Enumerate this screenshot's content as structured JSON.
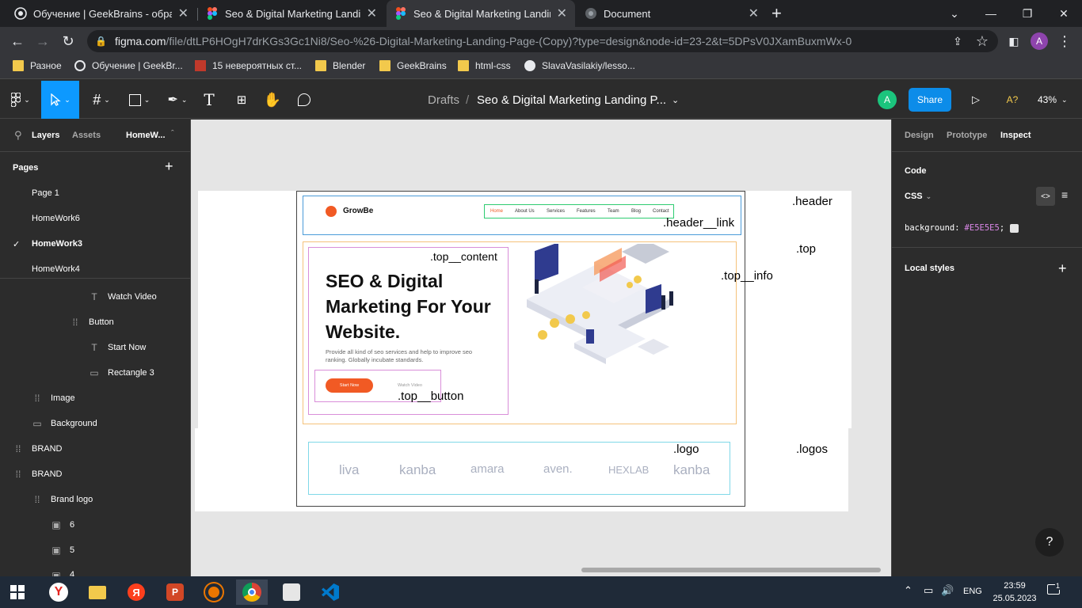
{
  "browser": {
    "tabs": [
      {
        "title": "Обучение | GeekBrains - образо",
        "icon": "geekbrains-icon"
      },
      {
        "title": "Seo & Digital Marketing Landing",
        "icon": "figma-icon"
      },
      {
        "title": "Seo & Digital Marketing Landing",
        "icon": "figma-icon"
      },
      {
        "title": "Document",
        "icon": "globe-icon"
      }
    ],
    "new_tab": "+",
    "url_host": "figma.com",
    "url_path": "/file/dtLP6HOgH7drKGs3Gc1Ni8/Seo-%26-Digital-Marketing-Landing-Page-(Copy)?type=design&node-id=23-2&t=5DPsV0JXamBuxmWx-0",
    "profile_initial": "A",
    "bookmarks": [
      "Разное",
      "Обучение | GeekBr...",
      "15 невероятных ст...",
      "Blender",
      "GeekBrains",
      "html-css",
      "SlavaVasilakiy/lesso..."
    ]
  },
  "figma": {
    "breadcrumb_root": "Drafts",
    "breadcrumb_sep": "/",
    "file_name": "Seo & Digital Marketing Landing P...",
    "user_initial": "A",
    "share_label": "Share",
    "ai_label": "A?",
    "zoom": "43%",
    "left_tabs": {
      "layers": "Layers",
      "assets": "Assets",
      "page": "HomeW..."
    },
    "pages_title": "Pages",
    "add_page": "+",
    "pages": [
      "Page 1",
      "HomeWork6",
      "HomeWork3",
      "HomeWork4"
    ],
    "layers": [
      {
        "label": "Watch Video",
        "icon": "T"
      },
      {
        "label": "Button",
        "icon": "frame"
      },
      {
        "label": "Start Now",
        "icon": "T"
      },
      {
        "label": "Rectangle 3",
        "icon": "rect"
      },
      {
        "label": "Image",
        "icon": "frame"
      },
      {
        "label": "Background",
        "icon": "rect"
      },
      {
        "label": "BRAND",
        "icon": "frame"
      },
      {
        "label": "BRAND",
        "icon": "frame"
      },
      {
        "label": "Brand logo",
        "icon": "frame"
      },
      {
        "label": "6",
        "icon": "image"
      },
      {
        "label": "5",
        "icon": "image"
      },
      {
        "label": "4",
        "icon": "image"
      }
    ],
    "right_tabs": {
      "design": "Design",
      "prototype": "Prototype",
      "inspect": "Inspect"
    },
    "code_title": "Code",
    "css_label": "CSS",
    "css_prop": "background:",
    "css_value": "#E5E5E5",
    "css_semicolon": ";",
    "local_styles": "Local styles",
    "help": "?"
  },
  "design": {
    "brand": "GrowBe",
    "nav": [
      "Home",
      "About Us",
      "Services",
      "Features",
      "Team",
      "Blog",
      "Contact"
    ],
    "hero_title": "SEO & Digital Marketing For Your Website.",
    "hero_text": "Provide all kind of seo services and help to improve seo ranking. Globally incubate standards.",
    "start_now": "Start Now",
    "watch_video": "Watch Video",
    "logos": [
      "liva",
      "kanba",
      "amara",
      "aven.",
      "HEXLAB",
      "kanba"
    ],
    "labels": {
      "header": ".header",
      "header_link": ".header__link",
      "top": ".top",
      "top_content": ".top__content",
      "top_info": ".top__info",
      "top_button": ".top__button",
      "logo": ".logo",
      "logos": ".logos"
    }
  },
  "taskbar": {
    "lang": "ENG",
    "time": "23:59",
    "date": "25.05.2023",
    "notifications": "1"
  },
  "colors": {
    "figma_blue": "#0d99ff",
    "share_blue": "#0c8ce9",
    "accent_orange": "#f15a24",
    "canvas_bg": "#e5e5e5",
    "css_value_color": "#d986e6"
  }
}
